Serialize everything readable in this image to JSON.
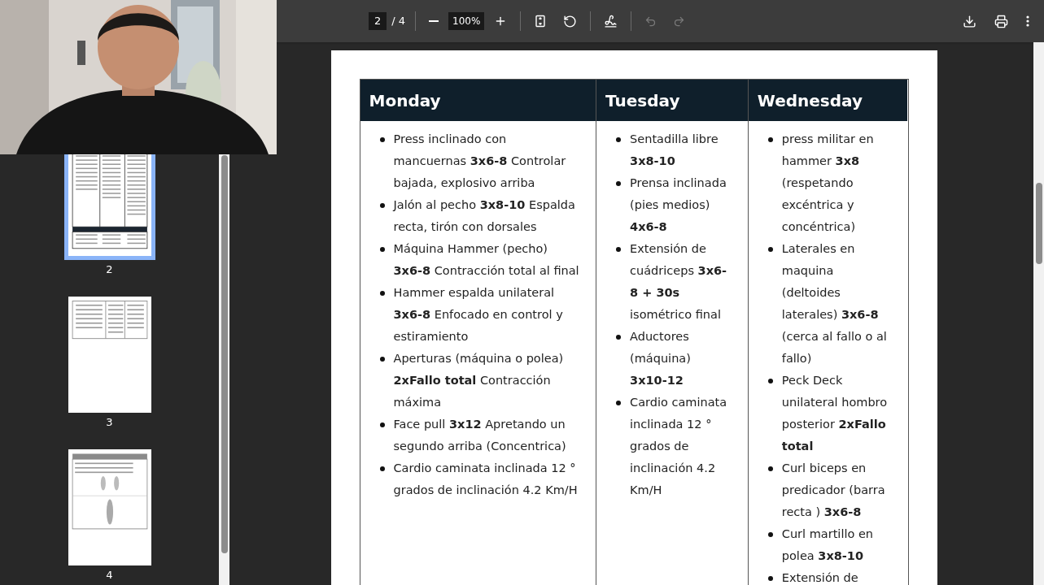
{
  "toolbar": {
    "page": "2",
    "page_count": "/ 4",
    "zoom": "100%"
  },
  "history_buttons": [
    {
      "kind": "undo",
      "disabled": true
    },
    {
      "kind": "redo",
      "disabled": true
    }
  ],
  "thumbnails": [
    {
      "label": "2",
      "selected": true,
      "kind": "full-table"
    },
    {
      "label": "3",
      "selected": false,
      "kind": "short-table"
    },
    {
      "label": "4",
      "selected": false,
      "kind": "figures"
    }
  ],
  "table": {
    "columns": [
      {
        "day": "Monday",
        "items": [
          "Press inclinado con mancuernas **3x6-8** Controlar bajada, explosivo arriba",
          "Jalón al pecho **3x8-10** Espalda recta, tirón con dorsales",
          "Máquina Hammer (pecho) **3x6-8** Contracción total al final",
          "Hammer espalda unilateral **3x6-8** Enfocado en control y estiramiento",
          "Aperturas (máquina o polea) **2xFallo total** Contracción máxima",
          "Face pull **3x12** Apretando un segundo arriba (Concentrica)",
          "Cardio caminata inclinada 12 ° grados de inclinación 4.2 Km/H"
        ]
      },
      {
        "day": "Tuesday",
        "items": [
          "Sentadilla libre **3x8-10**",
          "Prensa inclinada (pies medios) **4x6-8**",
          "Extensión de cuádriceps **3x6-8 + 30s** isométrico final",
          "Aductores (máquina) **3x10-12**",
          "Cardio caminata inclinada 12 ° grados de inclinación 4.2 Km/H"
        ]
      },
      {
        "day": "Wednesday",
        "items": [
          "press militar en hammer **3x8** (respetando excéntrica y concéntrica)",
          "Laterales en maquina (deltoides laterales) **3x6-8** (cerca al fallo o al fallo)",
          "Peck Deck unilateral hombro posterior **2xFallo total**",
          "Curl biceps en predicador (barra recta ) **3x6-8**",
          "Curl martillo en polea **3x8-10**",
          "Extensión de"
        ]
      }
    ]
  }
}
